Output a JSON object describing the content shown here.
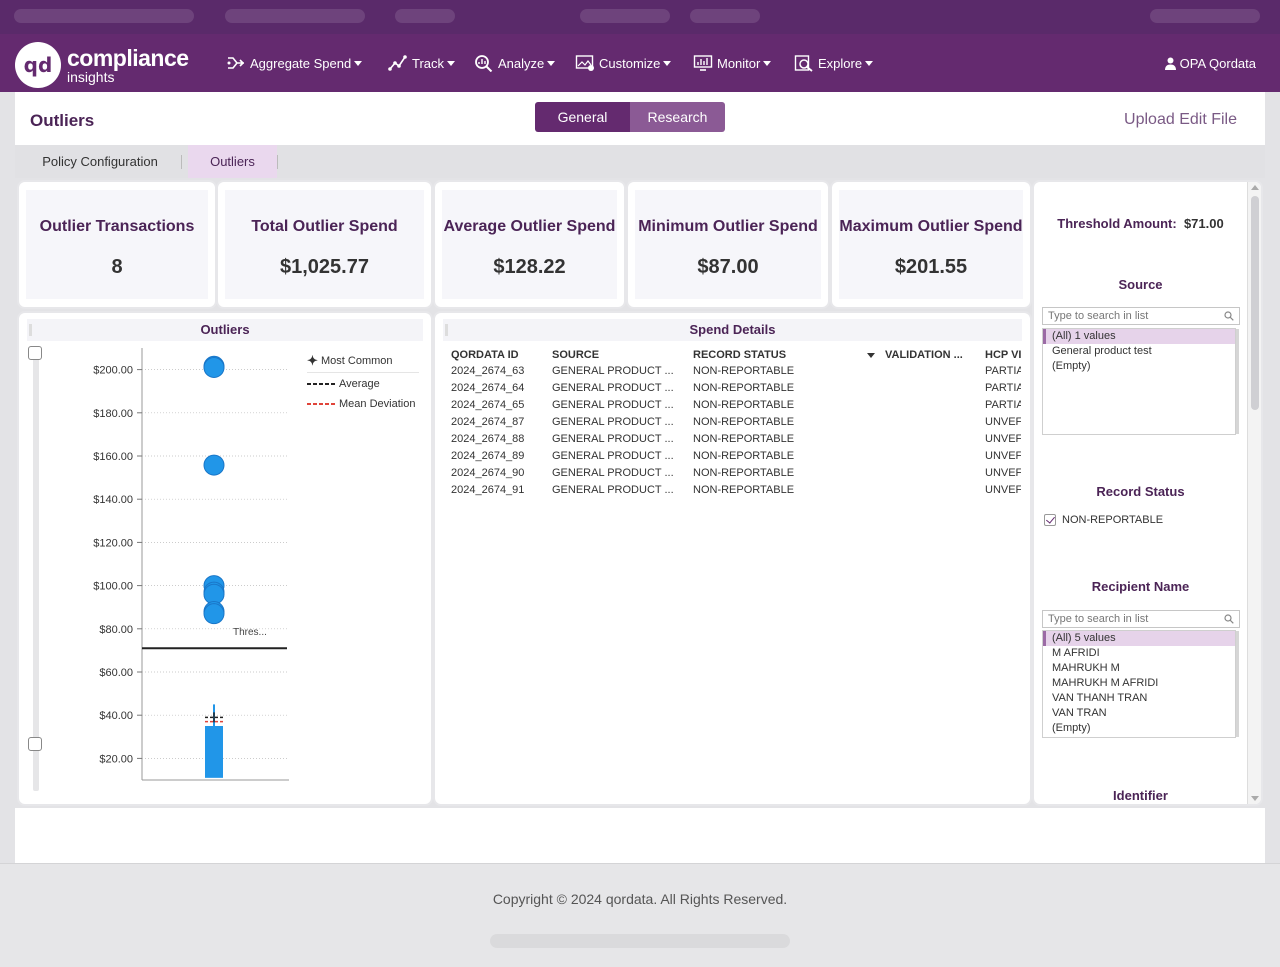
{
  "app": {
    "logo_mark": "qd",
    "logo_line1": "compliance",
    "logo_line2": "insights"
  },
  "nav": {
    "items": [
      {
        "label": "Aggregate Spend",
        "icon": "aggregate-spend-icon"
      },
      {
        "label": "Track",
        "icon": "track-icon"
      },
      {
        "label": "Analyze",
        "icon": "analyze-icon"
      },
      {
        "label": "Customize",
        "icon": "customize-icon"
      },
      {
        "label": "Monitor",
        "icon": "monitor-icon"
      },
      {
        "label": "Explore",
        "icon": "explore-icon"
      }
    ],
    "user": "OPA Qordata"
  },
  "page": {
    "title": "Outliers",
    "toggle": [
      "General",
      "Research"
    ],
    "active_toggle": "General",
    "upload_link": "Upload Edit File"
  },
  "tabs": [
    {
      "label": "Policy Configuration",
      "active": false
    },
    {
      "label": "Outliers",
      "active": true
    }
  ],
  "kpis": [
    {
      "label": "Outlier Transactions",
      "value": "8"
    },
    {
      "label": "Total Outlier Spend",
      "value": "$1,025.77"
    },
    {
      "label": "Average Outlier Spend",
      "value": "$128.22"
    },
    {
      "label": "Minimum Outlier Spend",
      "value": "$87.00"
    },
    {
      "label": "Maximum Outlier Spend",
      "value": "$201.55"
    }
  ],
  "outliers_panel": {
    "title": "Outliers",
    "legend": [
      "Most Common",
      "Average",
      "Mean Deviation"
    ],
    "threshold_label": "Thres..."
  },
  "chart_data": {
    "type": "scatter",
    "title": "Outliers",
    "ylim": [
      10,
      210
    ],
    "y_ticks": [
      "$200.00",
      "$180.00",
      "$160.00",
      "$140.00",
      "$120.00",
      "$100.00",
      "$80.00",
      "$60.00",
      "$40.00",
      "$20.00"
    ],
    "y_tick_values": [
      200,
      180,
      160,
      140,
      120,
      100,
      80,
      60,
      40,
      20
    ],
    "points": [
      201.55,
      201,
      155.8,
      100,
      97,
      96,
      88,
      87
    ],
    "threshold": 71,
    "box": {
      "low": 11,
      "high": 35,
      "whisker_high": 45,
      "average": 39,
      "mean_deviation": 37
    },
    "point_color": "#2196e8",
    "legend": [
      "Most Common",
      "Average",
      "Mean Deviation"
    ]
  },
  "spend_details": {
    "title": "Spend Details",
    "columns": [
      "QORDATA ID",
      "SOURCE",
      "RECORD STATUS",
      "VALIDATION ...",
      "HCP VI"
    ],
    "rows": [
      [
        "2024_2674_63",
        "GENERAL PRODUCT ...",
        "NON-REPORTABLE",
        "",
        "PARTIA"
      ],
      [
        "2024_2674_64",
        "GENERAL PRODUCT ...",
        "NON-REPORTABLE",
        "",
        "PARTIA"
      ],
      [
        "2024_2674_65",
        "GENERAL PRODUCT ...",
        "NON-REPORTABLE",
        "",
        "PARTIA"
      ],
      [
        "2024_2674_87",
        "GENERAL PRODUCT ...",
        "NON-REPORTABLE",
        "",
        "UNVEF"
      ],
      [
        "2024_2674_88",
        "GENERAL PRODUCT ...",
        "NON-REPORTABLE",
        "",
        "UNVEF"
      ],
      [
        "2024_2674_89",
        "GENERAL PRODUCT ...",
        "NON-REPORTABLE",
        "",
        "UNVEF"
      ],
      [
        "2024_2674_90",
        "GENERAL PRODUCT ...",
        "NON-REPORTABLE",
        "",
        "UNVEF"
      ],
      [
        "2024_2674_91",
        "GENERAL PRODUCT ...",
        "NON-REPORTABLE",
        "",
        "UNVEF"
      ]
    ]
  },
  "filters": {
    "threshold_label": "Threshold Amount:",
    "threshold_value": "$71.00",
    "source_label": "Source",
    "search_placeholder": "Type to search in list",
    "source_items": [
      "(All) 1 values",
      "General product test",
      "(Empty)"
    ],
    "record_status_label": "Record Status",
    "record_status_option": "NON-REPORTABLE",
    "recipient_label": "Recipient Name",
    "recipient_items": [
      "(All) 5 values",
      "M AFRIDI",
      "MAHRUKH M",
      "MAHRUKH M AFRIDI",
      "VAN THANH TRAN",
      "VAN TRAN",
      "(Empty)"
    ],
    "identifier_label": "Identifier"
  },
  "footer": {
    "copyright": "Copyright © 2024 qordata. All Rights Reserved."
  },
  "colors": {
    "brand_purple": "#642a6f",
    "accent_blue": "#2196e8"
  }
}
